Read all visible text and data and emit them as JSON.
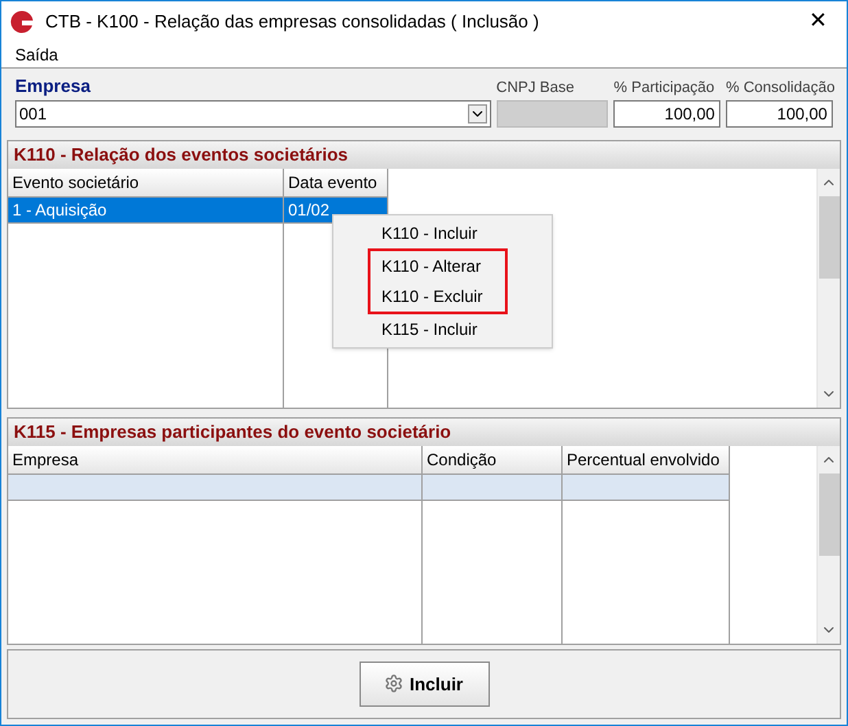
{
  "window": {
    "title": "CTB - K100 - Relação das empresas consolidadas ( Inclusão )",
    "close": "✕"
  },
  "menu": [
    "Saída"
  ],
  "header_fields": [
    {
      "label": "Empresa",
      "value": "001",
      "kind": "combo"
    },
    {
      "label": "CNPJ Base",
      "kind": "disabled"
    },
    {
      "label": "% Participação",
      "value": "100,00",
      "kind": "number"
    },
    {
      "label": "% Consolidação",
      "value": "100,00",
      "kind": "number"
    }
  ],
  "k110": {
    "title": "K110 - Relação dos eventos societários",
    "columns": [
      "Evento societário",
      "Data evento"
    ],
    "rows": [
      {
        "cells": [
          "1 - Aquisição",
          "01/02"
        ],
        "selected": true
      }
    ]
  },
  "context_menu": [
    {
      "label": "K110 - Incluir",
      "highlighted": false
    },
    {
      "label": "K110 - Alterar",
      "highlighted": true
    },
    {
      "label": "K110 - Excluir",
      "highlighted": true
    },
    {
      "label": "K115 - Incluir",
      "highlighted": false
    }
  ],
  "k115": {
    "title": "K115 - Empresas participantes do evento societário",
    "columns": [
      "Empresa",
      "Condição",
      "Percentual envolvido"
    ],
    "rows": [
      {
        "cells": [
          "",
          "",
          ""
        ],
        "selected": true
      }
    ]
  },
  "button": "Incluir"
}
